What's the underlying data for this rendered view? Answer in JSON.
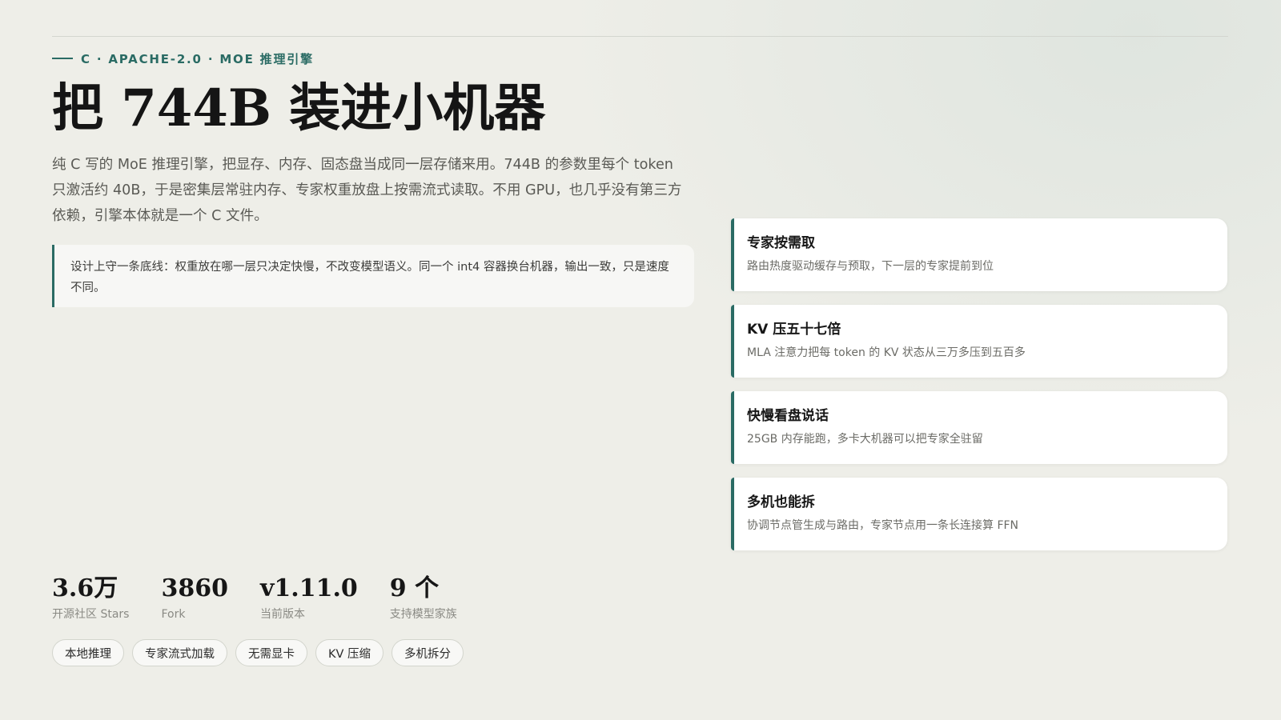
{
  "header": {
    "eyebrow": "C · APACHE-2.0 · MOE 推理引擎",
    "title": "把 744B 装进小机器",
    "lede": "纯 C 写的 MoE 推理引擎，把显存、内存、固态盘当成同一层存储来用。744B 的参数里每个 token 只激活约 40B，于是密集层常驻内存、专家权重放盘上按需流式读取。不用 GPU，也几乎没有第三方依赖，引擎本体就是一个 C 文件。"
  },
  "note": "设计上守一条底线：权重放在哪一层只决定快慢，不改变模型语义。同一个 int4 容器换台机器，输出一致，只是速度不同。",
  "features": [
    {
      "title": "专家按需取",
      "desc": "路由热度驱动缓存与预取，下一层的专家提前到位"
    },
    {
      "title": "KV 压五十七倍",
      "desc": "MLA 注意力把每 token 的 KV 状态从三万多压到五百多"
    },
    {
      "title": "快慢看盘说话",
      "desc": "25GB 内存能跑，多卡大机器可以把专家全驻留"
    },
    {
      "title": "多机也能拆",
      "desc": "协调节点管生成与路由，专家节点用一条长连接算 FFN"
    }
  ],
  "stats": [
    {
      "value": "3.6万",
      "label": "开源社区 Stars"
    },
    {
      "value": "3860",
      "label": "Fork"
    },
    {
      "value": "v1.11.0",
      "label": "当前版本"
    },
    {
      "value": "9 个",
      "label": "支持模型家族"
    }
  ],
  "tags": [
    "本地推理",
    "专家流式加载",
    "无需显卡",
    "KV 压缩",
    "多机拆分"
  ],
  "colors": {
    "accent": "#2a6b64",
    "background": "#eeeee8",
    "card": "#ffffff"
  }
}
